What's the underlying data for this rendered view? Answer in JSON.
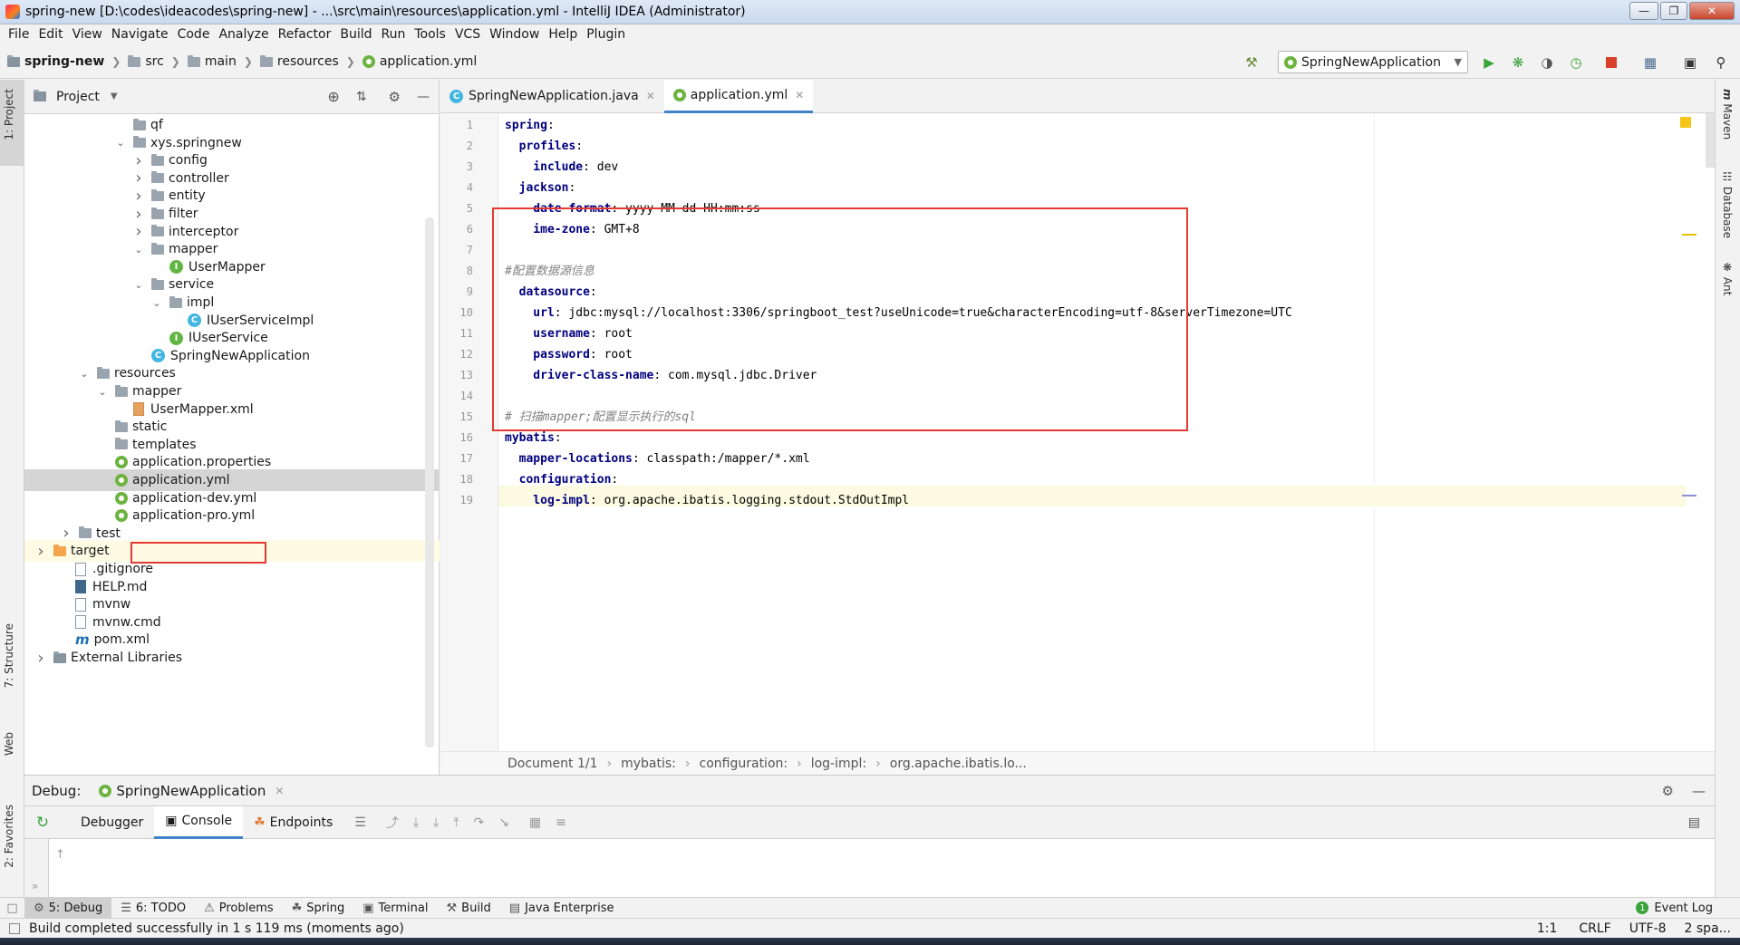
{
  "window": {
    "title": "spring-new [D:\\codes\\ideacodes\\spring-new] - ...\\src\\main\\resources\\application.yml - IntelliJ IDEA (Administrator)"
  },
  "menu": [
    "File",
    "Edit",
    "View",
    "Navigate",
    "Code",
    "Analyze",
    "Refactor",
    "Build",
    "Run",
    "Tools",
    "VCS",
    "Window",
    "Help",
    "Plugin"
  ],
  "nav_breadcrumb": [
    "spring-new",
    "src",
    "main",
    "resources",
    "application.yml"
  ],
  "run_config": "SpringNewApplication",
  "project_panel": {
    "title": "Project",
    "tree": [
      {
        "label": "qf",
        "indent": 1,
        "icon": "folder"
      },
      {
        "label": "xys.springnew",
        "indent": 1,
        "icon": "folder",
        "chev": "down"
      },
      {
        "label": "config",
        "indent": 2,
        "icon": "folder",
        "chev": "right"
      },
      {
        "label": "controller",
        "indent": 2,
        "icon": "folder",
        "chev": "right"
      },
      {
        "label": "entity",
        "indent": 2,
        "icon": "folder",
        "chev": "right"
      },
      {
        "label": "filter",
        "indent": 2,
        "icon": "folder",
        "chev": "right"
      },
      {
        "label": "interceptor",
        "indent": 2,
        "icon": "folder",
        "chev": "right"
      },
      {
        "label": "mapper",
        "indent": 2,
        "icon": "folder",
        "chev": "down"
      },
      {
        "label": "UserMapper",
        "indent": 3,
        "icon": "interface"
      },
      {
        "label": "service",
        "indent": 2,
        "icon": "folder",
        "chev": "down"
      },
      {
        "label": "impl",
        "indent": 3,
        "icon": "folder",
        "chev": "down"
      },
      {
        "label": "IUserServiceImpl",
        "indent": 4,
        "icon": "class"
      },
      {
        "label": "IUserService",
        "indent": 3,
        "icon": "interface"
      },
      {
        "label": "SpringNewApplication",
        "indent": 2,
        "icon": "class"
      },
      {
        "label": "resources",
        "indent": 0,
        "icon": "folder",
        "chev": "down",
        "base": 80
      },
      {
        "label": "mapper",
        "indent": 1,
        "icon": "folder",
        "chev": "down",
        "base": 80
      },
      {
        "label": "UserMapper.xml",
        "indent": 2,
        "icon": "xml",
        "base": 80
      },
      {
        "label": "static",
        "indent": 1,
        "icon": "folder",
        "base": 80
      },
      {
        "label": "templates",
        "indent": 1,
        "icon": "folder",
        "base": 80
      },
      {
        "label": "application.properties",
        "indent": 1,
        "icon": "spring",
        "base": 80
      },
      {
        "label": "application.yml",
        "indent": 1,
        "icon": "spring",
        "base": 80,
        "selected": true
      },
      {
        "label": "application-dev.yml",
        "indent": 1,
        "icon": "spring",
        "base": 80
      },
      {
        "label": "application-pro.yml",
        "indent": 1,
        "icon": "spring",
        "base": 80
      },
      {
        "label": "test",
        "indent": 0,
        "icon": "folder",
        "chev": "right",
        "base": 60
      },
      {
        "label": "target",
        "indent": 0,
        "icon": "folder-orange",
        "chev": "right",
        "base": 32,
        "hl": true
      },
      {
        "label": ".gitignore",
        "indent": 0,
        "icon": "file",
        "base": 56
      },
      {
        "label": "HELP.md",
        "indent": 0,
        "icon": "md",
        "base": 56
      },
      {
        "label": "mvnw",
        "indent": 0,
        "icon": "file",
        "base": 56
      },
      {
        "label": "mvnw.cmd",
        "indent": 0,
        "icon": "file",
        "base": 56
      },
      {
        "label": "pom.xml",
        "indent": 0,
        "icon": "maven",
        "base": 56
      },
      {
        "label": "External Libraries",
        "indent": 0,
        "icon": "lib",
        "base": 32,
        "chev": "right"
      }
    ]
  },
  "editor": {
    "tabs": [
      {
        "label": "SpringNewApplication.java",
        "active": false
      },
      {
        "label": "application.yml",
        "active": true
      }
    ],
    "lines": [
      [
        {
          "t": "spring",
          "c": "k"
        },
        {
          "t": ":",
          "c": "v"
        }
      ],
      [
        {
          "t": "  profiles",
          "c": "k"
        },
        {
          "t": ":",
          "c": "v"
        }
      ],
      [
        {
          "t": "    include",
          "c": "k"
        },
        {
          "t": ": dev",
          "c": "v"
        }
      ],
      [
        {
          "t": "  jackson",
          "c": "k"
        },
        {
          "t": ":",
          "c": "v"
        }
      ],
      [
        {
          "t": "    date-format",
          "c": "k"
        },
        {
          "t": ": yyyy-MM-dd HH:mm:ss",
          "c": "v"
        }
      ],
      [
        {
          "t": "    ime-zone",
          "c": "k"
        },
        {
          "t": ": GMT+8",
          "c": "v"
        }
      ],
      [],
      [
        {
          "t": "#配置数据源信息",
          "c": "cm"
        }
      ],
      [
        {
          "t": "  datasource",
          "c": "k"
        },
        {
          "t": ":",
          "c": "v"
        }
      ],
      [
        {
          "t": "    url",
          "c": "k"
        },
        {
          "t": ": jdbc:mysql://localhost:3306/springboot_test?useUnicode=true&characterEncoding=utf-8&serverTimezone=UTC",
          "c": "v"
        }
      ],
      [
        {
          "t": "    username",
          "c": "k"
        },
        {
          "t": ": root",
          "c": "v"
        }
      ],
      [
        {
          "t": "    password",
          "c": "k"
        },
        {
          "t": ": root",
          "c": "v"
        }
      ],
      [
        {
          "t": "    driver-class-name",
          "c": "k"
        },
        {
          "t": ": com.mysql.jdbc.Driver",
          "c": "v"
        }
      ],
      [],
      [
        {
          "t": "# 扫描mapper;配置显示执行的sql",
          "c": "cm"
        }
      ],
      [
        {
          "t": "mybatis",
          "c": "k"
        },
        {
          "t": ":",
          "c": "v"
        }
      ],
      [
        {
          "t": "  mapper-locations",
          "c": "k"
        },
        {
          "t": ": classpath:/mapper/*.xml",
          "c": "v"
        }
      ],
      [
        {
          "t": "  configuration",
          "c": "k"
        },
        {
          "t": ":",
          "c": "v"
        }
      ],
      [
        {
          "t": "    log-impl",
          "c": "k"
        },
        {
          "t": ": org.apache.ibatis.logging.stdout.StdOutImpl",
          "c": "v"
        }
      ]
    ],
    "breadcrumb": [
      "Document 1/1",
      "mybatis:",
      "configuration:",
      "log-impl:",
      "org.apache.ibatis.lo..."
    ]
  },
  "right_stripe": [
    "Maven",
    "Database",
    "Ant"
  ],
  "left_stripe": [
    "1: Project",
    "7: Structure",
    "Web",
    "2: Favorites"
  ],
  "debug": {
    "label": "Debug:",
    "session": "SpringNewApplication",
    "tabs": [
      "Debugger",
      "Console",
      "Endpoints"
    ],
    "active_tab": "Console"
  },
  "tool_windows": [
    "5: Debug",
    "6: TODO",
    "Problems",
    "Spring",
    "Terminal",
    "Build",
    "Java Enterprise"
  ],
  "event_log": "Event Log",
  "status": {
    "message": "Build completed successfully in 1 s 119 ms (moments ago)",
    "position": "1:1",
    "line_sep": "CRLF",
    "encoding": "UTF-8",
    "indent": "2 spa..."
  },
  "colors": {
    "accent": "#4083c9",
    "highlight_box": "#e53935",
    "yaml_key": "#000080"
  }
}
